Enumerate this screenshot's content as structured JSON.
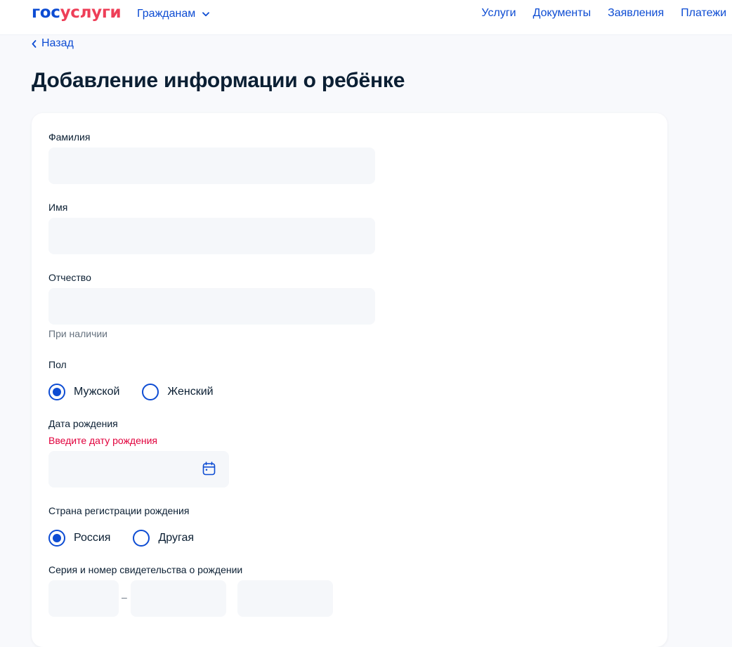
{
  "header": {
    "logo_part1": "гос",
    "logo_part2": "услуги",
    "citizens_label": "Гражданам",
    "nav": [
      {
        "label": "Услуги"
      },
      {
        "label": "Документы"
      },
      {
        "label": "Заявления"
      },
      {
        "label": "Платежи"
      }
    ]
  },
  "back_label": "Назад",
  "page_title": "Добавление информации о ребёнке",
  "form": {
    "last_name": {
      "label": "Фамилия",
      "value": ""
    },
    "first_name": {
      "label": "Имя",
      "value": ""
    },
    "patronymic": {
      "label": "Отчество",
      "value": "",
      "hint": "При наличии"
    },
    "gender": {
      "label": "Пол",
      "options": [
        {
          "label": "Мужской",
          "selected": true
        },
        {
          "label": "Женский",
          "selected": false
        }
      ]
    },
    "birth_date": {
      "label": "Дата рождения",
      "error": "Введите дату рождения",
      "value": ""
    },
    "birth_country": {
      "label": "Страна регистрации рождения",
      "options": [
        {
          "label": "Россия",
          "selected": true
        },
        {
          "label": "Другая",
          "selected": false
        }
      ]
    },
    "certificate": {
      "label": "Серия и номер свидетельства о рождении",
      "series_roman": "",
      "series_letters": "",
      "number": "",
      "separator": "–"
    }
  },
  "colors": {
    "accent": "#0d4cd3",
    "logo_red": "#ee3f58",
    "error": "#e1003c",
    "input_bg": "#f5f7fa",
    "page_bg": "#f8f9fc"
  }
}
